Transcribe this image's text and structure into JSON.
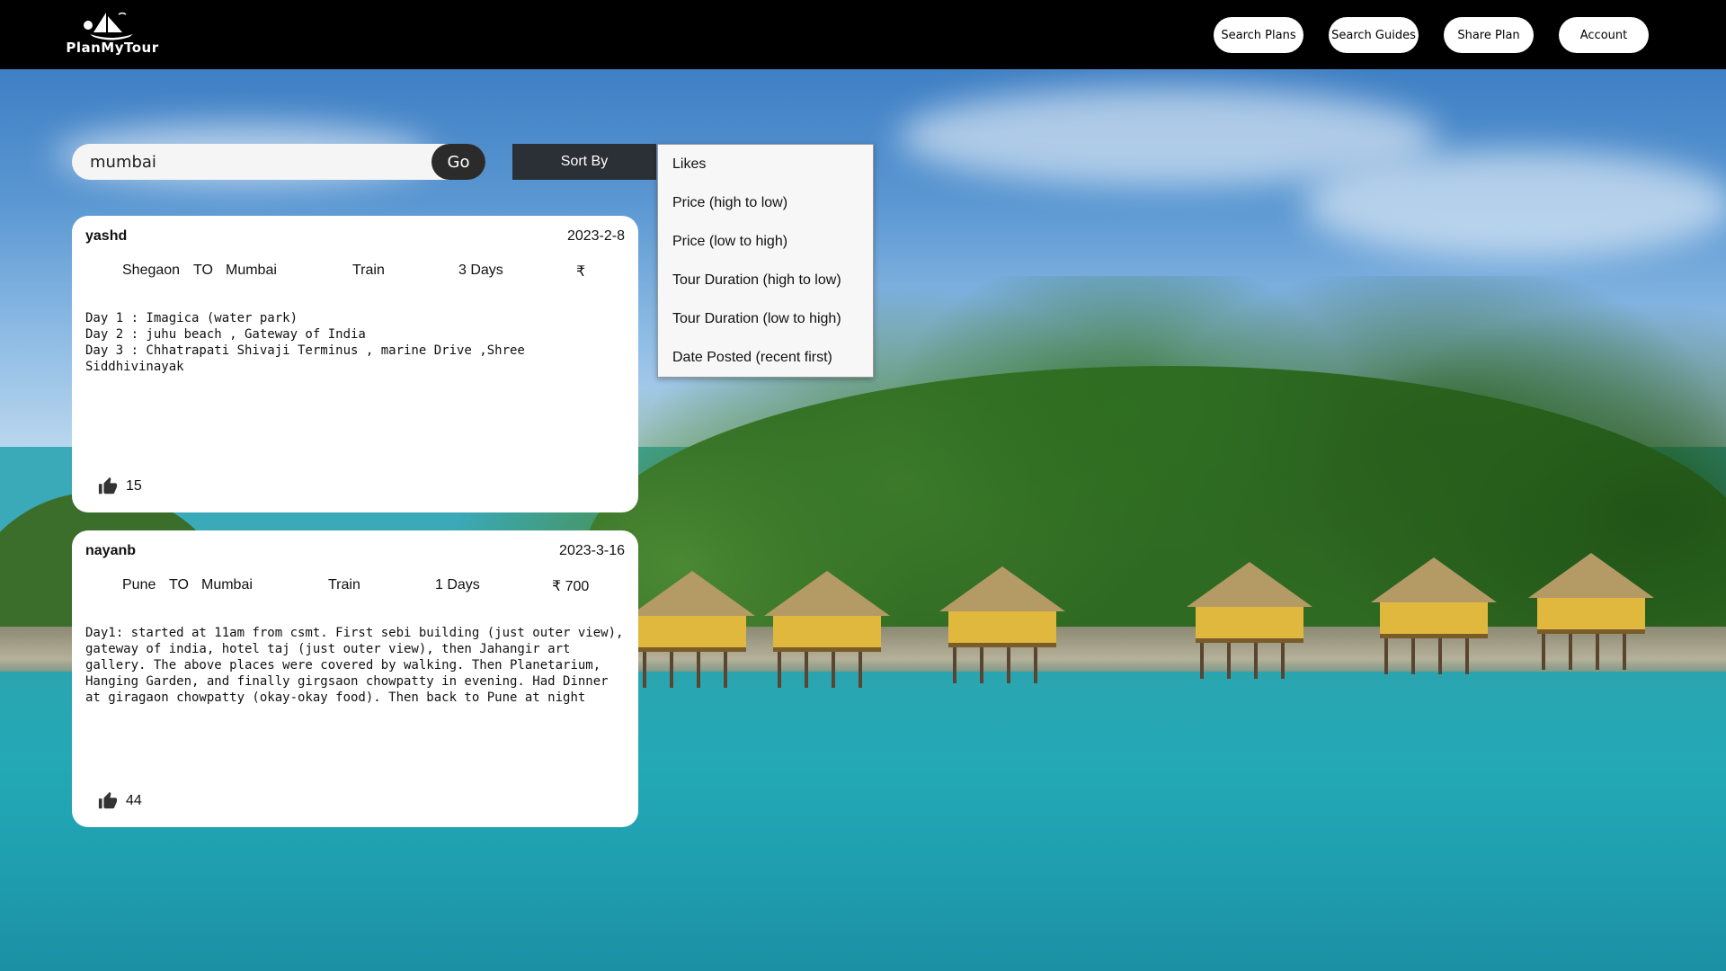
{
  "header": {
    "logo_text": "PlanMyTour",
    "nav": [
      {
        "label": "Search Plans"
      },
      {
        "label": "Search Guides"
      },
      {
        "label": "Share Plan"
      },
      {
        "label": "Account"
      }
    ]
  },
  "search": {
    "value": "mumbai",
    "go_label": "Go"
  },
  "sort": {
    "label": "Sort By",
    "options": [
      {
        "label": "Likes"
      },
      {
        "label": "Price (high to low)"
      },
      {
        "label": "Price (low to high)"
      },
      {
        "label": "Tour Duration (high to low)"
      },
      {
        "label": "Tour Duration (low to high)"
      },
      {
        "label": "Date Posted (recent first)"
      }
    ]
  },
  "plans": [
    {
      "user": "yashd",
      "date": "2023-2-8",
      "from": "Shegaon",
      "to_word": "TO",
      "to": "Mumbai",
      "mode": "Train",
      "duration": "3 Days",
      "price": "₹",
      "description": "Day 1 : Imagica (water park)\nDay 2 : juhu beach , Gateway of India\nDay 3 : Chhatrapati Shivaji Terminus , marine Drive ,Shree Siddhivinayak",
      "likes": "15"
    },
    {
      "user": "nayanb",
      "date": "2023-3-16",
      "from": "Pune",
      "to_word": "TO",
      "to": "Mumbai",
      "mode": "Train",
      "duration": "1 Days",
      "price": "₹ 700",
      "description": "Day1: started at 11am from csmt. First sebi building (just outer view), gateway of india, hotel taj (just outer view), then Jahangir art gallery. The above places were covered by walking. Then Planetarium, Hanging Garden, and finally girgsaon chowpatty in evening. Had Dinner at giragaon chowpatty (okay-okay food). Then back to Pune at night",
      "likes": "44"
    }
  ],
  "colors": {
    "header_bg": "#000000",
    "card_bg": "#ffffff",
    "go_button": "#2b2b2b",
    "sort_button": "#2b2f36"
  },
  "icons": {
    "like": "thumbs-up-icon",
    "logo": "sailboat-logo"
  }
}
